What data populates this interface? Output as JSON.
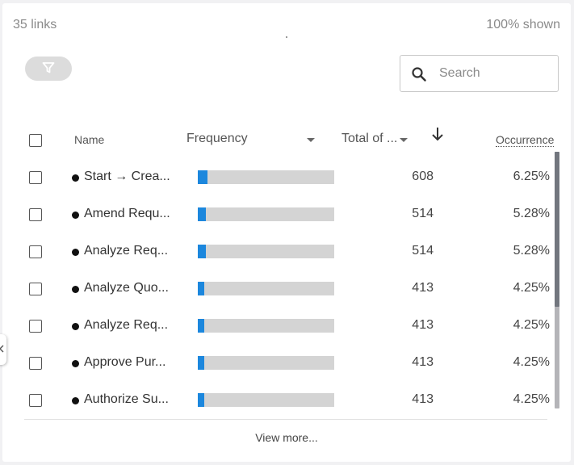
{
  "header": {
    "link_count": "35 links",
    "shown": "100% shown"
  },
  "search": {
    "placeholder": "Search",
    "value": ""
  },
  "columns": {
    "name": "Name",
    "frequency": "Frequency",
    "total": "Total of ...",
    "occurrence": "Occurrence"
  },
  "sort": {
    "column": "total",
    "direction": "descending"
  },
  "rows": [
    {
      "name": "Start → Crea...",
      "total": "608",
      "occurrence": "6.25%",
      "frequency_fraction": 0.0625
    },
    {
      "name": "Amend Requ...",
      "total": "514",
      "occurrence": "5.28%",
      "frequency_fraction": 0.0528
    },
    {
      "name": "Analyze Req...",
      "total": "514",
      "occurrence": "5.28%",
      "frequency_fraction": 0.0528
    },
    {
      "name": "Analyze Quo...",
      "total": "413",
      "occurrence": "4.25%",
      "frequency_fraction": 0.0425
    },
    {
      "name": "Analyze Req...",
      "total": "413",
      "occurrence": "4.25%",
      "frequency_fraction": 0.0425
    },
    {
      "name": "Approve Pur...",
      "total": "413",
      "occurrence": "4.25%",
      "frequency_fraction": 0.0425
    },
    {
      "name": "Authorize Su...",
      "total": "413",
      "occurrence": "4.25%",
      "frequency_fraction": 0.0425
    }
  ],
  "footer": {
    "view_more": "View more..."
  },
  "colors": {
    "accent": "#1c87dd",
    "bar_track": "#d4d4d4",
    "filter_button": "#dcdcdc"
  },
  "icons": {
    "filter": "filter-icon",
    "search": "search-icon",
    "sort": "arrow-down-icon",
    "side_tab": "chevron-left-icon"
  }
}
